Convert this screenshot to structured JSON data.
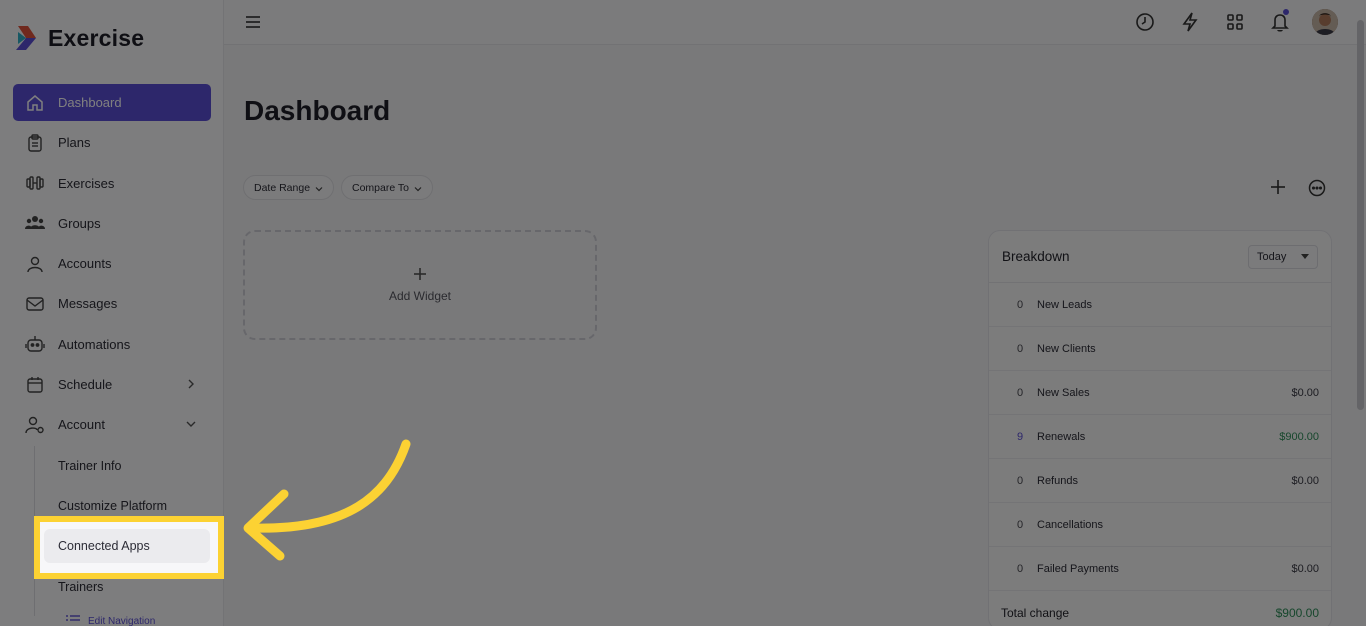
{
  "app": {
    "name": "Exercise"
  },
  "sidebar": {
    "items": [
      {
        "label": "Dashboard",
        "icon": "home-icon",
        "active": true
      },
      {
        "label": "Plans",
        "icon": "clipboard-icon"
      },
      {
        "label": "Exercises",
        "icon": "dumbbell-icon"
      },
      {
        "label": "Groups",
        "icon": "users-icon"
      },
      {
        "label": "Accounts",
        "icon": "user-icon"
      },
      {
        "label": "Messages",
        "icon": "mail-icon"
      },
      {
        "label": "Automations",
        "icon": "robot-icon"
      },
      {
        "label": "Schedule",
        "icon": "calendar-icon"
      },
      {
        "label": "Account",
        "icon": "user-gear-icon"
      }
    ],
    "sub_items": [
      "Trainer Info",
      "Customize Platform",
      "Connected Apps",
      "Trainers"
    ],
    "edit_nav": "Edit Navigation"
  },
  "main": {
    "title": "Dashboard",
    "filters": {
      "date_range": "Date Range",
      "compare_to": "Compare To"
    },
    "add_widget": "Add Widget"
  },
  "breakdown": {
    "title": "Breakdown",
    "period": "Today",
    "rows": [
      {
        "count": "0",
        "label": "New Leads",
        "amount": ""
      },
      {
        "count": "0",
        "label": "New Clients",
        "amount": ""
      },
      {
        "count": "0",
        "label": "New Sales",
        "amount": "$0.00"
      },
      {
        "count": "9",
        "label": "Renewals",
        "amount": "$900.00"
      },
      {
        "count": "0",
        "label": "Refunds",
        "amount": "$0.00"
      },
      {
        "count": "0",
        "label": "Cancellations",
        "amount": ""
      },
      {
        "count": "0",
        "label": "Failed Payments",
        "amount": "$0.00"
      }
    ],
    "total_label": "Total change",
    "total_amount": "$900.00"
  },
  "colors": {
    "accent": "#5b4fd6",
    "highlight": "#fcd233",
    "positive": "#2f8f5a"
  }
}
